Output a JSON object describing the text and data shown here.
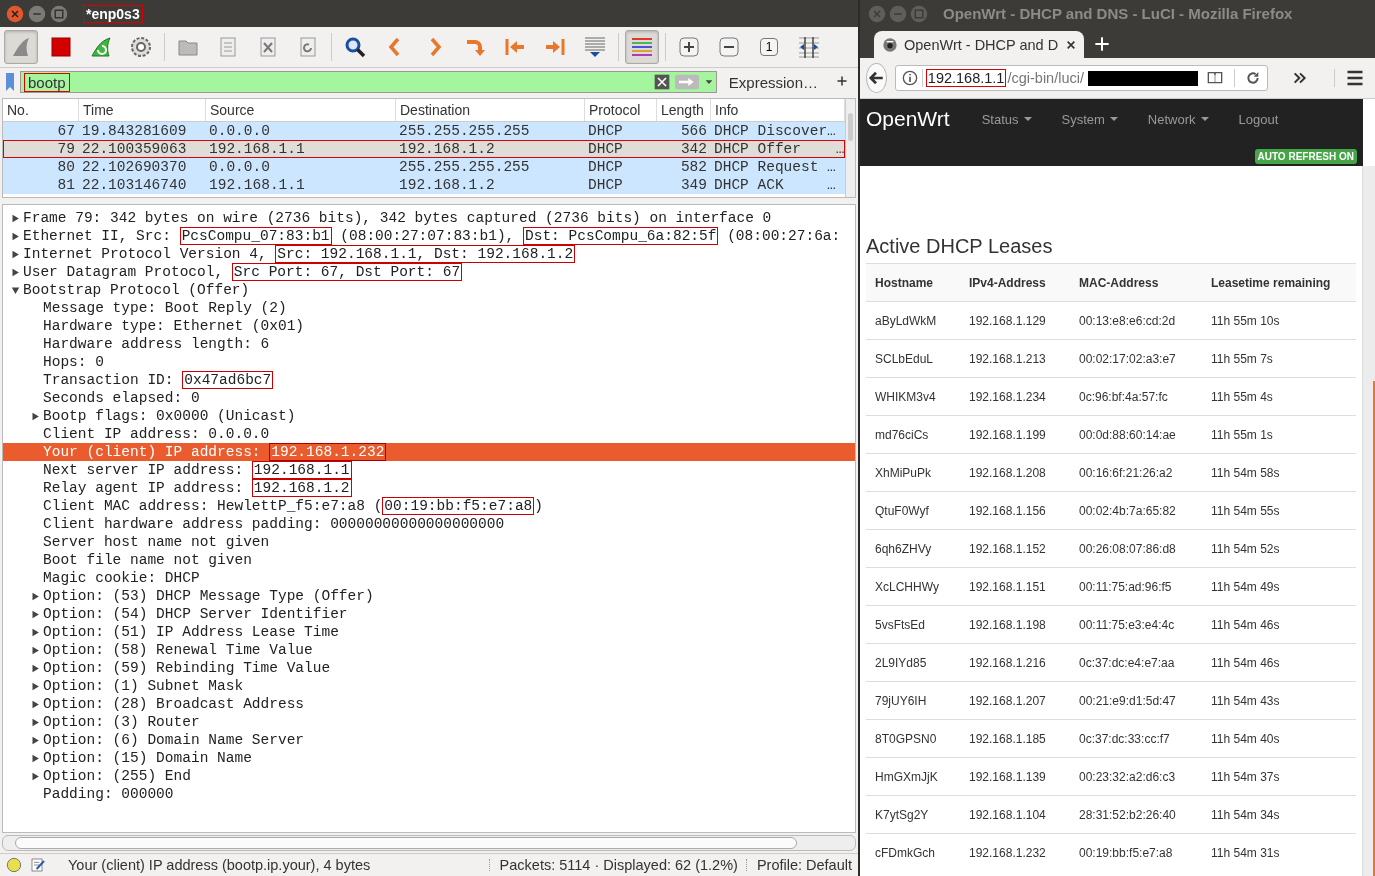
{
  "capture_window": {
    "title": {
      "text": "*enp0s3",
      "boxed": true
    },
    "toolbar": [
      {
        "kind": "start",
        "pressed": true
      },
      {
        "kind": "stop",
        "pressed": false
      },
      {
        "kind": "restart",
        "pressed": false
      },
      {
        "kind": "options",
        "pressed": false
      },
      {
        "kind": "separator"
      },
      {
        "kind": "open",
        "pressed": false
      },
      {
        "kind": "save",
        "pressed": false
      },
      {
        "kind": "close",
        "pressed": false
      },
      {
        "kind": "reload",
        "pressed": false
      },
      {
        "kind": "separator"
      },
      {
        "kind": "find",
        "pressed": false
      },
      {
        "kind": "back",
        "pressed": false
      },
      {
        "kind": "forward",
        "pressed": false
      },
      {
        "kind": "goto",
        "pressed": false
      },
      {
        "kind": "first",
        "pressed": false
      },
      {
        "kind": "last",
        "pressed": false
      },
      {
        "kind": "autoscroll",
        "pressed": false
      },
      {
        "kind": "separator"
      },
      {
        "kind": "colorize",
        "pressed": true
      },
      {
        "kind": "separator"
      },
      {
        "kind": "zoom-in",
        "pressed": false
      },
      {
        "kind": "zoom-out",
        "pressed": false
      },
      {
        "kind": "zoom-reset",
        "pressed": false,
        "glyph": "1"
      },
      {
        "kind": "resize",
        "pressed": false
      }
    ],
    "filter": {
      "value": "bootp",
      "boxed": true,
      "expression_button": "Expression…"
    },
    "packet_list": {
      "columns": [
        "No.",
        "Time",
        "Source",
        "Destination",
        "Protocol",
        "Length",
        "Info"
      ],
      "rows": [
        {
          "no": "67",
          "time": "19.843281609",
          "source": "0.0.0.0",
          "destination": "255.255.255.255",
          "protocol": "DHCP",
          "length": "566",
          "info": "DHCP Discover…",
          "selected": false,
          "boxed": false
        },
        {
          "no": "79",
          "time": "22.100359063",
          "source": "192.168.1.1",
          "destination": "192.168.1.2",
          "protocol": "DHCP",
          "length": "342",
          "info": "DHCP Offer    …",
          "selected": true,
          "boxed": true
        },
        {
          "no": "80",
          "time": "22.102690370",
          "source": "0.0.0.0",
          "destination": "255.255.255.255",
          "protocol": "DHCP",
          "length": "582",
          "info": "DHCP Request …",
          "selected": false,
          "boxed": false
        },
        {
          "no": "81",
          "time": "22.103146740",
          "source": "192.168.1.1",
          "destination": "192.168.1.2",
          "protocol": "DHCP",
          "length": "349",
          "info": "DHCP ACK     …",
          "selected": false,
          "boxed": false
        }
      ]
    },
    "details": [
      {
        "text": "Frame 79: 342 bytes on wire (2736 bits), 342 bytes captured (2736 bits) on interface 0",
        "expanded": false,
        "selected": false
      },
      {
        "parts": [
          {
            "text": "Ethernet II, Src: ",
            "boxed": false
          },
          {
            "text": "PcsCompu_07:83:b1",
            "boxed": true
          },
          {
            "text": " (08:00:27:07:83:b1), ",
            "boxed": false
          },
          {
            "text": "Dst: PcsCompu_6a:82:5f",
            "boxed": true
          },
          {
            "text": " (08:00:27:6a:",
            "boxed": false
          }
        ],
        "expanded": false,
        "selected": false
      },
      {
        "parts": [
          {
            "text": "Internet Protocol Version 4, ",
            "boxed": false
          },
          {
            "text": "Src: 192.168.1.1, Dst: 192.168.1.2",
            "boxed": true
          }
        ],
        "expanded": false,
        "selected": false
      },
      {
        "parts": [
          {
            "text": "User Datagram Protocol, ",
            "boxed": false
          },
          {
            "text": "Src Port: 67, Dst Port: 67",
            "boxed": true
          }
        ],
        "expanded": false,
        "selected": false
      },
      {
        "text": "Bootstrap Protocol (Offer)",
        "expanded": true,
        "selected": false,
        "children": [
          {
            "text": "Message type: Boot Reply (2)",
            "selected": false
          },
          {
            "text": "Hardware type: Ethernet (0x01)",
            "selected": false
          },
          {
            "text": "Hardware address length: 6",
            "selected": false
          },
          {
            "text": "Hops: 0",
            "selected": false
          },
          {
            "parts": [
              {
                "text": "Transaction ID: ",
                "boxed": false
              },
              {
                "text": "0x47ad6bc7",
                "boxed": true
              }
            ],
            "selected": false
          },
          {
            "text": "Seconds elapsed: 0",
            "selected": false
          },
          {
            "text": "Bootp flags: 0x0000 (Unicast)",
            "expanded": false,
            "selected": false
          },
          {
            "text": "Client IP address: 0.0.0.0",
            "selected": false
          },
          {
            "parts": [
              {
                "text": "Your (client) IP address: ",
                "boxed": false
              },
              {
                "text": "192.168.1.232",
                "boxed": true
              }
            ],
            "selected": true
          },
          {
            "parts": [
              {
                "text": "Next server IP address: ",
                "boxed": false
              },
              {
                "text": "192.168.1.1",
                "boxed": true
              }
            ],
            "selected": false
          },
          {
            "parts": [
              {
                "text": "Relay agent IP address: ",
                "boxed": false
              },
              {
                "text": "192.168.1.2",
                "boxed": true
              }
            ],
            "selected": false
          },
          {
            "parts": [
              {
                "text": "Client MAC address: HewlettP_f5:e7:a8 (",
                "boxed": false
              },
              {
                "text": "00:19:bb:f5:e7:a8",
                "boxed": true
              },
              {
                "text": ")",
                "boxed": false
              }
            ],
            "selected": false
          },
          {
            "text": "Client hardware address padding: 00000000000000000000",
            "selected": false
          },
          {
            "text": "Server host name not given",
            "selected": false
          },
          {
            "text": "Boot file name not given",
            "selected": false
          },
          {
            "text": "Magic cookie: DHCP",
            "selected": false
          },
          {
            "text": "Option: (53) DHCP Message Type (Offer)",
            "expanded": false,
            "selected": false
          },
          {
            "text": "Option: (54) DHCP Server Identifier",
            "expanded": false,
            "selected": false
          },
          {
            "text": "Option: (51) IP Address Lease Time",
            "expanded": false,
            "selected": false
          },
          {
            "text": "Option: (58) Renewal Time Value",
            "expanded": false,
            "selected": false
          },
          {
            "text": "Option: (59) Rebinding Time Value",
            "expanded": false,
            "selected": false
          },
          {
            "text": "Option: (1) Subnet Mask",
            "expanded": false,
            "selected": false
          },
          {
            "text": "Option: (28) Broadcast Address",
            "expanded": false,
            "selected": false
          },
          {
            "text": "Option: (3) Router",
            "expanded": false,
            "selected": false
          },
          {
            "text": "Option: (6) Domain Name Server",
            "expanded": false,
            "selected": false
          },
          {
            "text": "Option: (15) Domain Name",
            "expanded": false,
            "selected": false
          },
          {
            "text": "Option: (255) End",
            "expanded": false,
            "selected": false
          },
          {
            "text": "Padding: 000000",
            "selected": false
          }
        ]
      }
    ],
    "status_bar": {
      "field_info": "Your (client) IP address (bootp.ip.your), 4 bytes",
      "packets": "Packets: 5114 · Displayed: 62 (1.2%)",
      "profile": "Profile: Default"
    }
  },
  "browser_window": {
    "title": "OpenWrt - DHCP and DNS - LuCI - Mozilla Firefox",
    "tab": {
      "title": "OpenWrt - DHCP and D",
      "selected": true
    },
    "url": {
      "host": "192.168.1.1",
      "host_boxed": true,
      "path": "/cgi-bin/luci/"
    },
    "site": {
      "brand": "OpenWrt",
      "menu": [
        {
          "label": "Status",
          "dropdown": true
        },
        {
          "label": "System",
          "dropdown": true
        },
        {
          "label": "Network",
          "dropdown": true
        },
        {
          "label": "Logout",
          "dropdown": false
        }
      ],
      "badge": "AUTO REFRESH ON"
    },
    "leases": {
      "heading": "Active DHCP Leases",
      "columns": [
        "Hostname",
        "IPv4-Address",
        "MAC-Address",
        "Leasetime remaining"
      ],
      "rows": [
        [
          "aByLdWkM",
          "192.168.1.129",
          "00:13:e8:e6:cd:2d",
          "11h 55m 10s"
        ],
        [
          "SCLbEduL",
          "192.168.1.213",
          "00:02:17:02:a3:e7",
          "11h 55m 7s"
        ],
        [
          "WHIKM3v4",
          "192.168.1.234",
          "0c:96:bf:4a:57:fc",
          "11h 55m 4s"
        ],
        [
          "md76ciCs",
          "192.168.1.199",
          "00:0d:88:60:14:ae",
          "11h 55m 1s"
        ],
        [
          "XhMiPuPk",
          "192.168.1.208",
          "00:16:6f:21:26:a2",
          "11h 54m 58s"
        ],
        [
          "QtuF0Wyf",
          "192.168.1.156",
          "00:02:4b:7a:65:82",
          "11h 54m 55s"
        ],
        [
          "6qh6ZHVy",
          "192.168.1.152",
          "00:26:08:07:86:d8",
          "11h 54m 52s"
        ],
        [
          "XcLCHHWy",
          "192.168.1.151",
          "00:11:75:ad:96:f5",
          "11h 54m 49s"
        ],
        [
          "5vsFtsEd",
          "192.168.1.198",
          "00:11:75:e3:e4:4c",
          "11h 54m 46s"
        ],
        [
          "2L9IYd85",
          "192.168.1.216",
          "0c:37:dc:e4:e7:aa",
          "11h 54m 46s"
        ],
        [
          "79jUY6IH",
          "192.168.1.207",
          "00:21:e9:d1:5d:47",
          "11h 54m 43s"
        ],
        [
          "8T0GPSN0",
          "192.168.1.185",
          "0c:37:dc:33:cc:f7",
          "11h 54m 40s"
        ],
        [
          "HmGXmJjK",
          "192.168.1.139",
          "00:23:32:a2:d6:c3",
          "11h 54m 37s"
        ],
        [
          "K7ytSg2Y",
          "192.168.1.104",
          "28:31:52:b2:26:40",
          "11h 54m 34s"
        ],
        [
          "cFDmkGch",
          "192.168.1.232",
          "00:19:bb:f5:e7:a8",
          "11h 54m 31s"
        ]
      ]
    }
  }
}
